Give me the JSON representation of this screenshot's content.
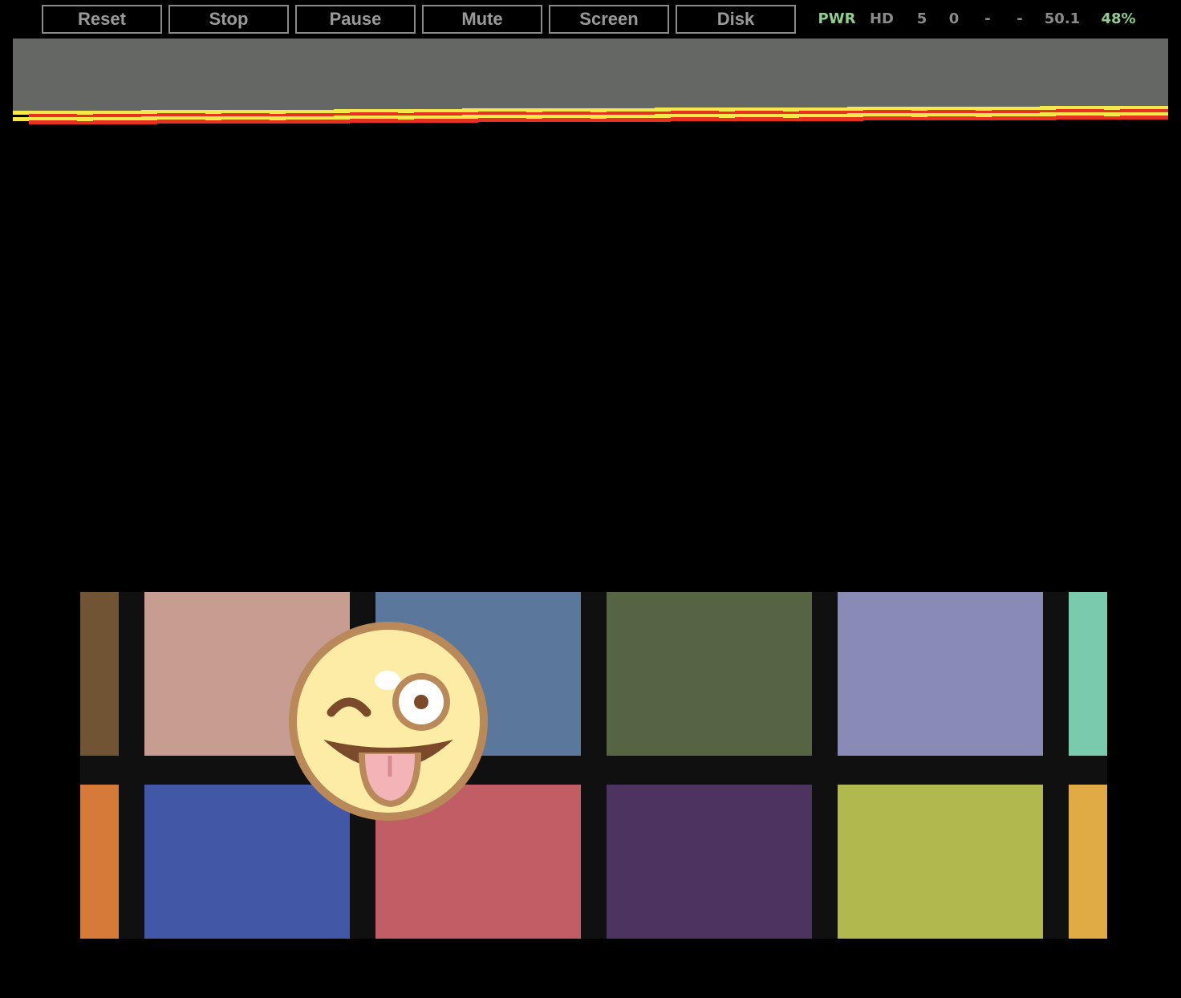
{
  "toolbar": {
    "buttons": [
      {
        "id": "reset",
        "label": "Reset"
      },
      {
        "id": "stop",
        "label": "Stop"
      },
      {
        "id": "pause",
        "label": "Pause"
      },
      {
        "id": "mute",
        "label": "Mute"
      },
      {
        "id": "screen",
        "label": "Screen"
      },
      {
        "id": "disk",
        "label": "Disk"
      }
    ],
    "status": {
      "pwr": "PWR",
      "hd": "HD",
      "drive1": "5",
      "drive2": "0",
      "indicator1": "-",
      "indicator2": "-",
      "fps": "50.1",
      "speed": "48%"
    },
    "colors": {
      "button_border": "#8a8a8a",
      "button_text": "#9a9a9a",
      "status_text": "#8a8a8a",
      "status_active": "#8fce8f"
    }
  },
  "screen": {
    "background": "#000000",
    "band": {
      "gray": "#646764",
      "stripe_red": "#e83220",
      "stripe_yellow": "#f5e84a"
    },
    "palette": {
      "top_row": [
        "#705433",
        "#c79c91",
        "#5b779b",
        "#556443",
        "#8a8ab7",
        "#7acaad"
      ],
      "bottom_row": [
        "#d57a39",
        "#4257a5",
        "#c15e65",
        "#4d335f",
        "#b1b84e",
        "#e0ab45"
      ],
      "gap_color": "#101010"
    },
    "emoji": {
      "name": "winking-face-with-tongue-icon",
      "face": "#fdeca5",
      "outline": "#b9895a",
      "mouth": "#7a4a2a",
      "tongue": "#f2b4b7"
    }
  }
}
